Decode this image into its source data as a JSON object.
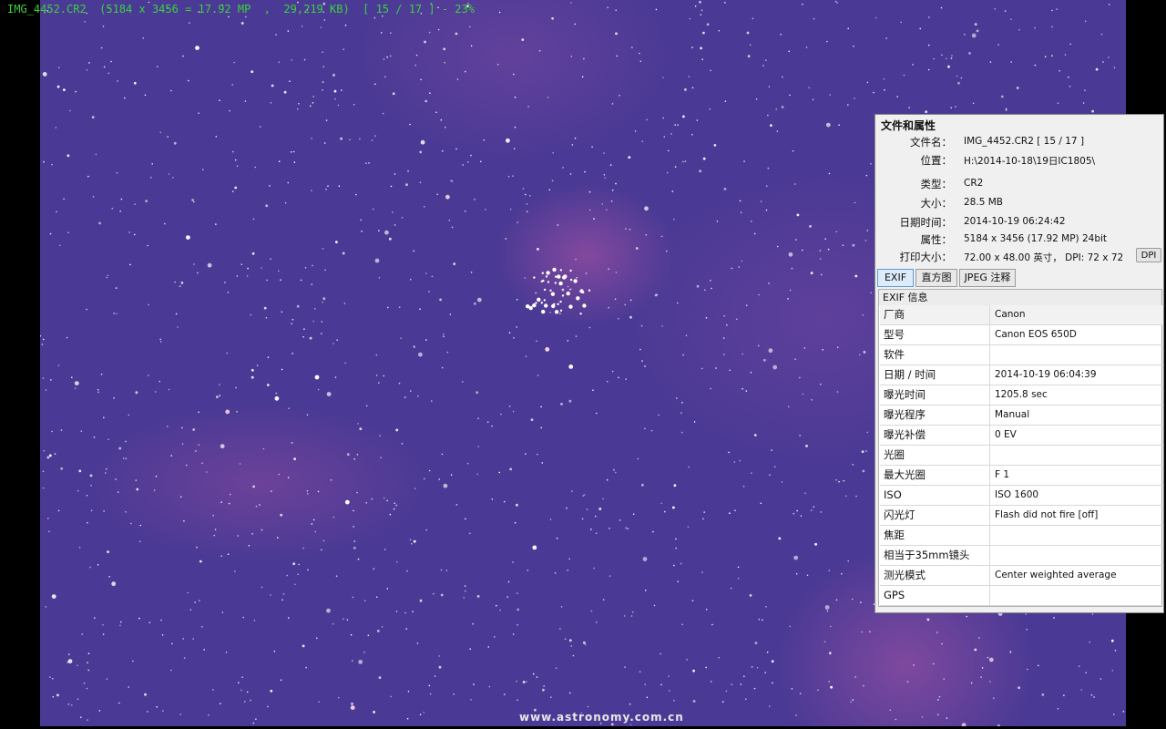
{
  "viewer": {
    "title_bar": "IMG_4452.CR2  (5184 x 3456 = 17.92 MP  ,  29,219 KB)  [ 15 / 17 ] - 23%",
    "watermark": "www.astronomy.com.cn",
    "sky_color": "#4b3a95",
    "title_color": "#3ad23a"
  },
  "panel": {
    "title": "文件和属性",
    "rows": [
      {
        "label": "文件名：",
        "value": "IMG_4452.CR2   [ 15 / 17 ]"
      },
      {
        "label": "位置：",
        "value": "H:\\2014-10-18\\19日IC1805\\"
      },
      {
        "label": "类型：",
        "value": "CR2"
      },
      {
        "label": "大小：",
        "value": "28.5 MB"
      },
      {
        "label": "日期时间：",
        "value": "2014-10-19 06:24:42"
      },
      {
        "label": "属性：",
        "value": "5184 x 3456 (17.92 MP)  24bit"
      },
      {
        "label": "打印大小：",
        "value": "72.00 x 48.00 英寸，  DPI: 72 x 72"
      }
    ],
    "dpi_button": "DPI",
    "tabs": [
      {
        "label": "EXIF",
        "active": true
      },
      {
        "label": "直方图",
        "active": false
      },
      {
        "label": "JPEG 注释",
        "active": false
      }
    ],
    "exif_heading": "EXIF 信息",
    "exif": [
      {
        "key": "厂商",
        "value": "Canon"
      },
      {
        "key": "型号",
        "value": "Canon EOS 650D"
      },
      {
        "key": "软件",
        "value": ""
      },
      {
        "key": "日期 / 时间",
        "value": "2014-10-19 06:04:39"
      },
      {
        "key": "曝光时间",
        "value": "1205.8 sec"
      },
      {
        "key": "曝光程序",
        "value": "Manual"
      },
      {
        "key": "曝光补偿",
        "value": "0 EV"
      },
      {
        "key": "光圈",
        "value": ""
      },
      {
        "key": "最大光圈",
        "value": "F 1"
      },
      {
        "key": "ISO",
        "value": "ISO 1600"
      },
      {
        "key": "闪光灯",
        "value": "Flash did not fire [off]"
      },
      {
        "key": "焦距",
        "value": ""
      },
      {
        "key": "相当于35mm镜头",
        "value": ""
      },
      {
        "key": "测光模式",
        "value": "Center weighted average"
      },
      {
        "key": "GPS",
        "value": ""
      }
    ]
  }
}
